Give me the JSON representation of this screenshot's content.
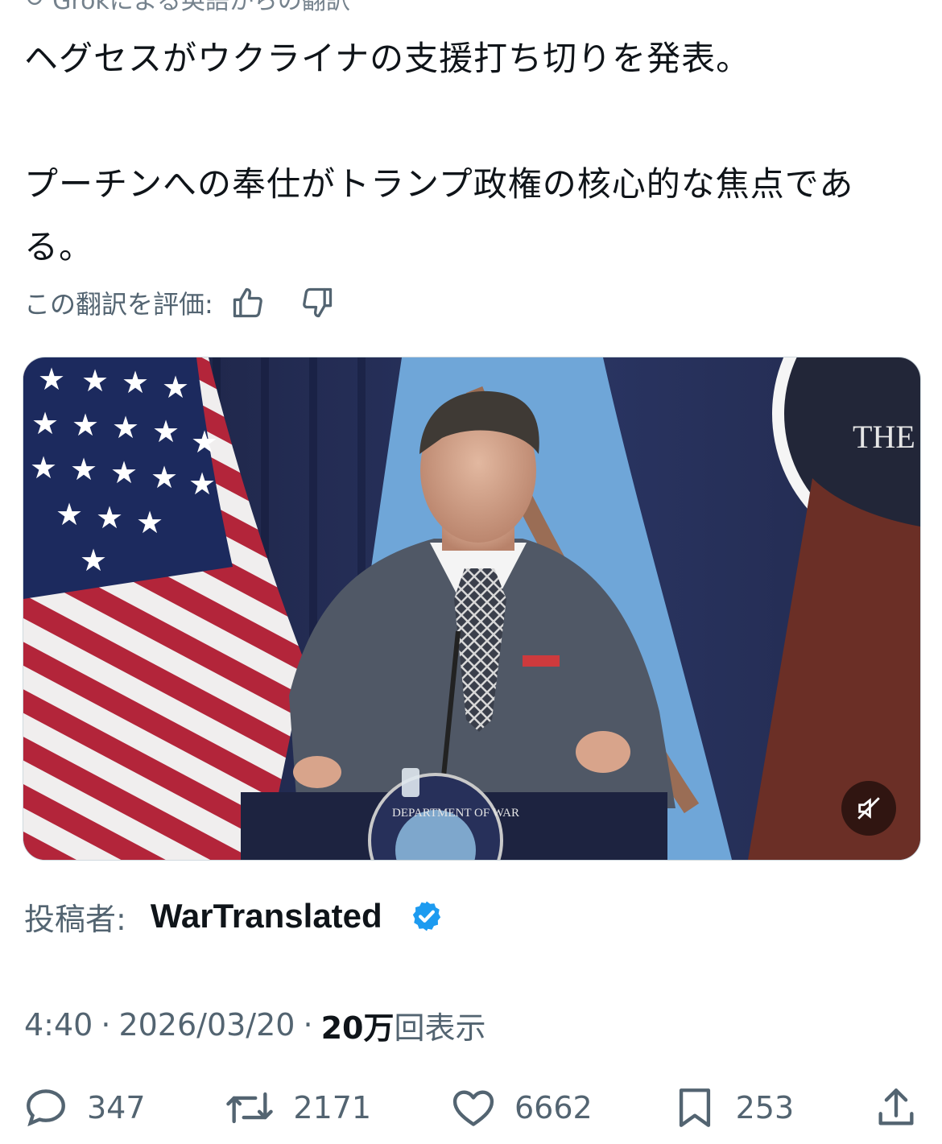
{
  "header": {
    "translation_notice": "Grokによる英語からの翻訳"
  },
  "tweet": {
    "paragraphs": [
      "ヘグセスがウクライナの支援打ち切りを発表。",
      "プーチンへの奉仕がトランプ政権の核心的な焦点である。"
    ]
  },
  "rating": {
    "label": "この翻訳を評価:",
    "thumbs_up_icon": "thumbs-up-icon",
    "thumbs_down_icon": "thumbs-down-icon"
  },
  "video": {
    "logo_text": "THE",
    "podium_seal_text": "DEPARTMENT OF WAR",
    "mute_icon": "muted-speaker-icon"
  },
  "author": {
    "prefix": "投稿者:",
    "name": "WarTranslated",
    "verified_color": "#1d9bf0"
  },
  "meta": {
    "time": "4:40",
    "separator": "·",
    "date": "2026/03/20",
    "views_count": "20万",
    "views_label": "回表示"
  },
  "actions": {
    "replies": "347",
    "reposts": "2171",
    "likes": "6662",
    "bookmarks": "253",
    "reply_icon": "reply-icon",
    "repost_icon": "repost-icon",
    "like_icon": "heart-icon",
    "bookmark_icon": "bookmark-icon",
    "share_icon": "share-icon"
  },
  "colors": {
    "text_primary": "#0f1419",
    "text_secondary": "#536471",
    "accent": "#1d9bf0"
  }
}
